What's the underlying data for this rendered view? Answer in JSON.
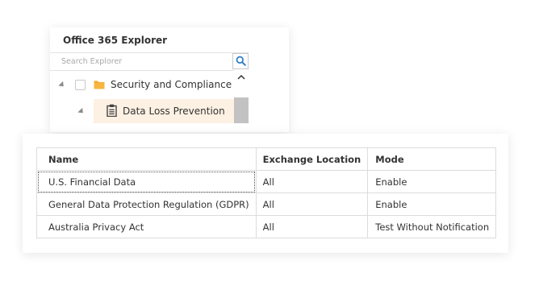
{
  "explorer": {
    "title": "Office 365 Explorer",
    "search": {
      "placeholder": "Search Explorer",
      "value": "",
      "icon": "search-icon"
    },
    "tree": [
      {
        "label": "Security and Compliance",
        "icon": "folder-icon",
        "expanded": true,
        "checked": false
      },
      {
        "label": "Data Loss Prevention",
        "icon": "clipboard-icon",
        "expanded": true,
        "selected": true
      }
    ]
  },
  "table": {
    "headers": [
      "Name",
      "Exchange Location",
      "Mode"
    ],
    "rows": [
      [
        "U.S. Financial Data",
        "All",
        "Enable"
      ],
      [
        "General Data Protection Regulation (GDPR)",
        "All",
        "Enable"
      ],
      [
        "Australia Privacy Act",
        "All",
        "Test Without Notification"
      ]
    ]
  },
  "colors": {
    "accent": "#2a7cc7",
    "folder": "#f5a623",
    "selected_background": "#fdf1e3"
  }
}
